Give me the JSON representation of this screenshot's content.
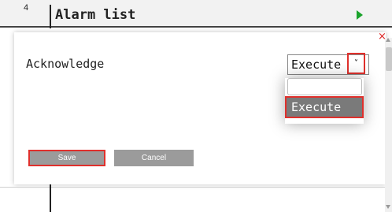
{
  "header": {
    "row_number": "4",
    "title": "Alarm list",
    "run_icon": "play-icon"
  },
  "dialog": {
    "close_icon": "close-icon",
    "field_label": "Acknowledge",
    "select": {
      "value": "Execute",
      "chevron_icon": "chevron-down-icon",
      "options": [
        "",
        "Execute"
      ],
      "highlighted_option": "Execute"
    },
    "save_label": "Save",
    "cancel_label": "Cancel"
  },
  "colors": {
    "highlight_border": "#e0302c",
    "play_icon": "#1aa32b",
    "selected_option_bg": "#7a7a7a",
    "button_bg": "#9b9b9b"
  }
}
